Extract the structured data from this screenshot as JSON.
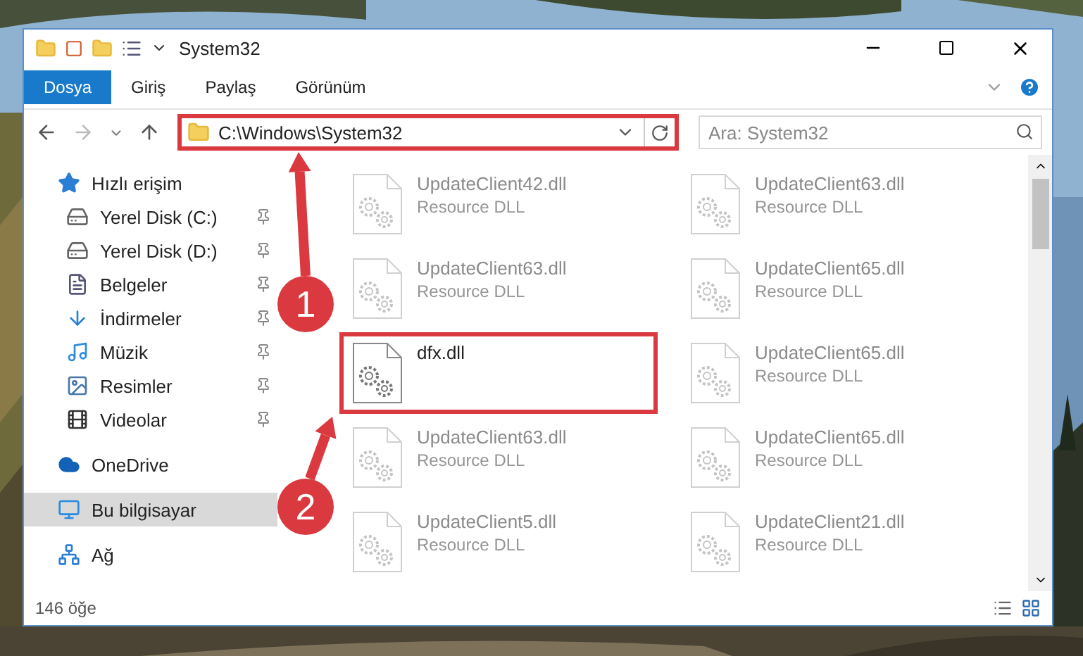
{
  "window": {
    "title": "System32"
  },
  "ribbon": {
    "tabs": [
      {
        "label": "Dosya",
        "selected": true
      },
      {
        "label": "Giriş",
        "selected": false
      },
      {
        "label": "Paylaş",
        "selected": false
      },
      {
        "label": "Görünüm",
        "selected": false
      }
    ]
  },
  "address_bar": {
    "path": "C:\\Windows\\System32",
    "highlighted": true
  },
  "search": {
    "placeholder": "Ara: System32"
  },
  "sidebar": {
    "items": [
      {
        "label": "Hızlı erişim",
        "kind": "star",
        "selected": false,
        "pinned": false,
        "children": [
          {
            "label": "Yerel Disk (C:)",
            "kind": "drive",
            "selected": false,
            "pinned": true
          },
          {
            "label": "Yerel Disk (D:)",
            "kind": "drive",
            "selected": false,
            "pinned": true
          },
          {
            "label": "Belgeler",
            "kind": "documents",
            "selected": false,
            "pinned": true
          },
          {
            "label": "İndirmeler",
            "kind": "downloads",
            "selected": false,
            "pinned": true
          },
          {
            "label": "Müzik",
            "kind": "music",
            "selected": false,
            "pinned": true
          },
          {
            "label": "Resimler",
            "kind": "pictures",
            "selected": false,
            "pinned": true
          },
          {
            "label": "Videolar",
            "kind": "videos",
            "selected": false,
            "pinned": true
          }
        ]
      },
      {
        "label": "OneDrive",
        "kind": "cloud",
        "selected": false,
        "pinned": false
      },
      {
        "label": "Bu bilgisayar",
        "kind": "computer",
        "selected": true,
        "pinned": false
      },
      {
        "label": "Ağ",
        "kind": "network",
        "selected": false,
        "pinned": false
      }
    ]
  },
  "files": [
    {
      "name": "UpdateClient42.dll",
      "type": "Resource DLL",
      "dimmed": true,
      "highlighted": false
    },
    {
      "name": "UpdateClient63.dll",
      "type": "Resource DLL",
      "dimmed": true,
      "highlighted": false
    },
    {
      "name": "UpdateClient63.dll",
      "type": "Resource DLL",
      "dimmed": true,
      "highlighted": false
    },
    {
      "name": "UpdateClient65.dll",
      "type": "Resource DLL",
      "dimmed": true,
      "highlighted": false
    },
    {
      "name": "dfx.dll",
      "dimmed": false,
      "highlighted": true
    },
    {
      "name": "UpdateClient65.dll",
      "type": "Resource DLL",
      "dimmed": true,
      "highlighted": false
    },
    {
      "name": "UpdateClient63.dll",
      "type": "Resource DLL",
      "dimmed": true,
      "highlighted": false
    },
    {
      "name": "UpdateClient65.dll",
      "type": "Resource DLL",
      "dimmed": true,
      "highlighted": false
    },
    {
      "name": "UpdateClient5.dll",
      "type": "Resource DLL",
      "dimmed": true,
      "highlighted": false
    },
    {
      "name": "UpdateClient21.dll",
      "type": "Resource DLL",
      "dimmed": true,
      "highlighted": false
    }
  ],
  "status_bar": {
    "count": "146 öğe"
  },
  "annotations": [
    {
      "number": "1"
    },
    {
      "number": "2"
    }
  ]
}
